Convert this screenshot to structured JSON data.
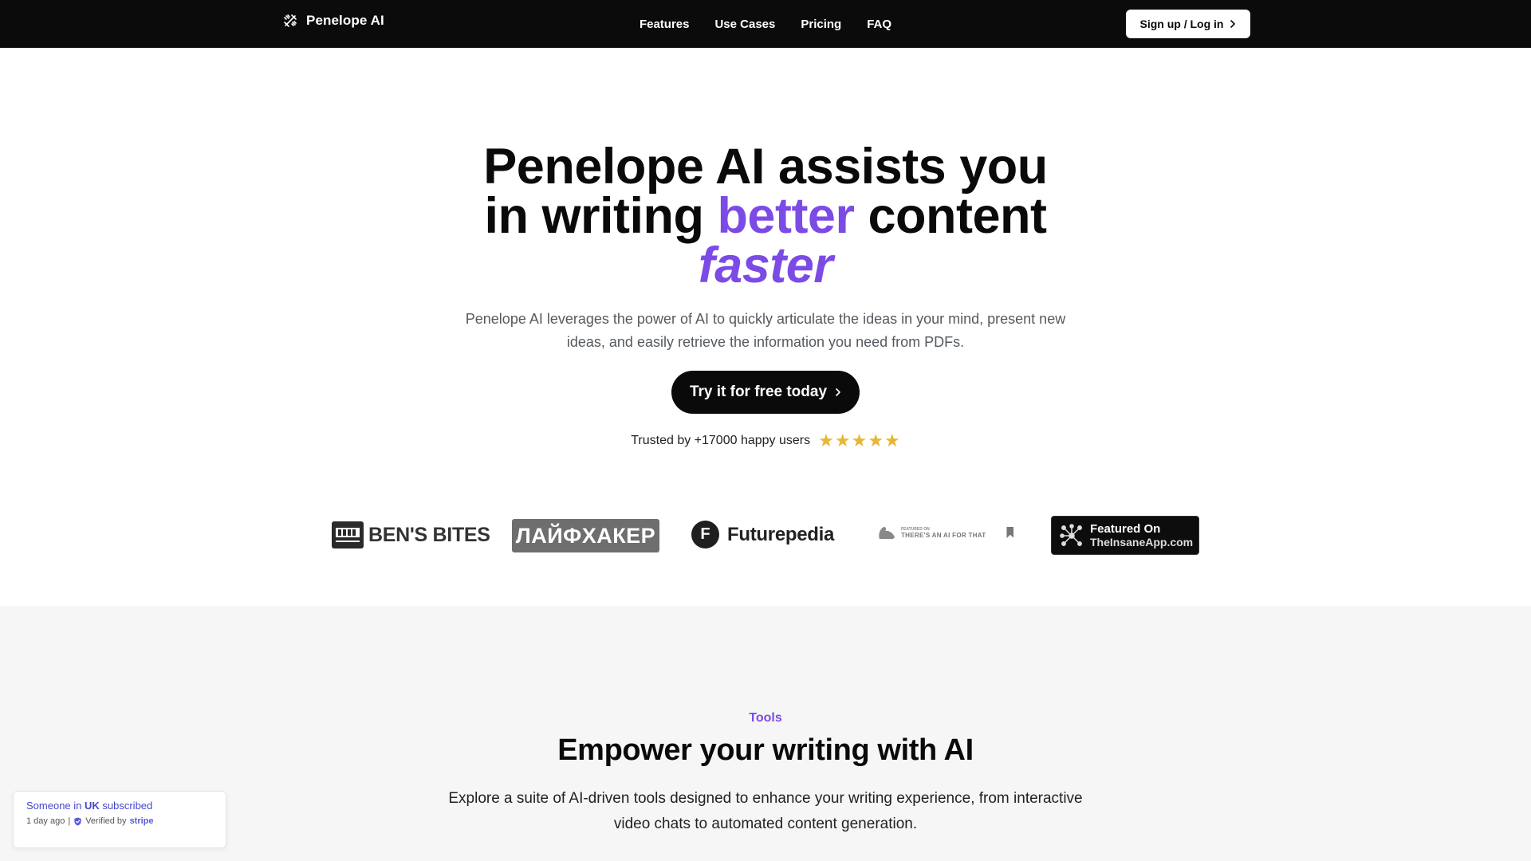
{
  "nav": {
    "brand": "Penelope AI",
    "links": [
      "Features",
      "Use Cases",
      "Pricing",
      "FAQ"
    ],
    "signup_label": "Sign up / Log in"
  },
  "hero": {
    "title_line1": "Penelope AI assists you",
    "title_line2_a": "in writing ",
    "title_line2_accent": "better",
    "title_line2_b": " content",
    "title_line3": "faster",
    "subtitle": "Penelope AI leverages the power of AI to quickly articulate the ideas in your mind, present new ideas, and easily retrieve the information you need from PDFs.",
    "cta_label": "Try it for free today",
    "trust_text": "Trusted by +17000 happy users",
    "rating_stars": 5
  },
  "logos": {
    "bens_bites": "BEN'S BITES",
    "lifehacker": "ЛАЙФХАКЕР",
    "futurepedia_mark": "F",
    "futurepedia": "Futurepedia",
    "aift_small": "FEATURED ON",
    "aift_text": "THERE'S AN AI FOR THAT",
    "insane_line1": "Featured On",
    "insane_line2": "TheInsaneApp.com"
  },
  "tools": {
    "label": "Tools",
    "title": "Empower your writing with AI",
    "description": "Explore a suite of AI-driven tools designed to enhance your writing experience, from interactive video chats to automated content generation."
  },
  "toast": {
    "prefix": "Someone in ",
    "country": "UK",
    "suffix": " subscribed",
    "time": "1 day ago",
    "separator": "|",
    "verified": "Verified by",
    "verifier": "stripe"
  },
  "colors": {
    "accent": "#7c4be6",
    "nav_bg": "#0b0b0b",
    "star": "#e8b634",
    "section_bg": "#f6f6f6"
  }
}
